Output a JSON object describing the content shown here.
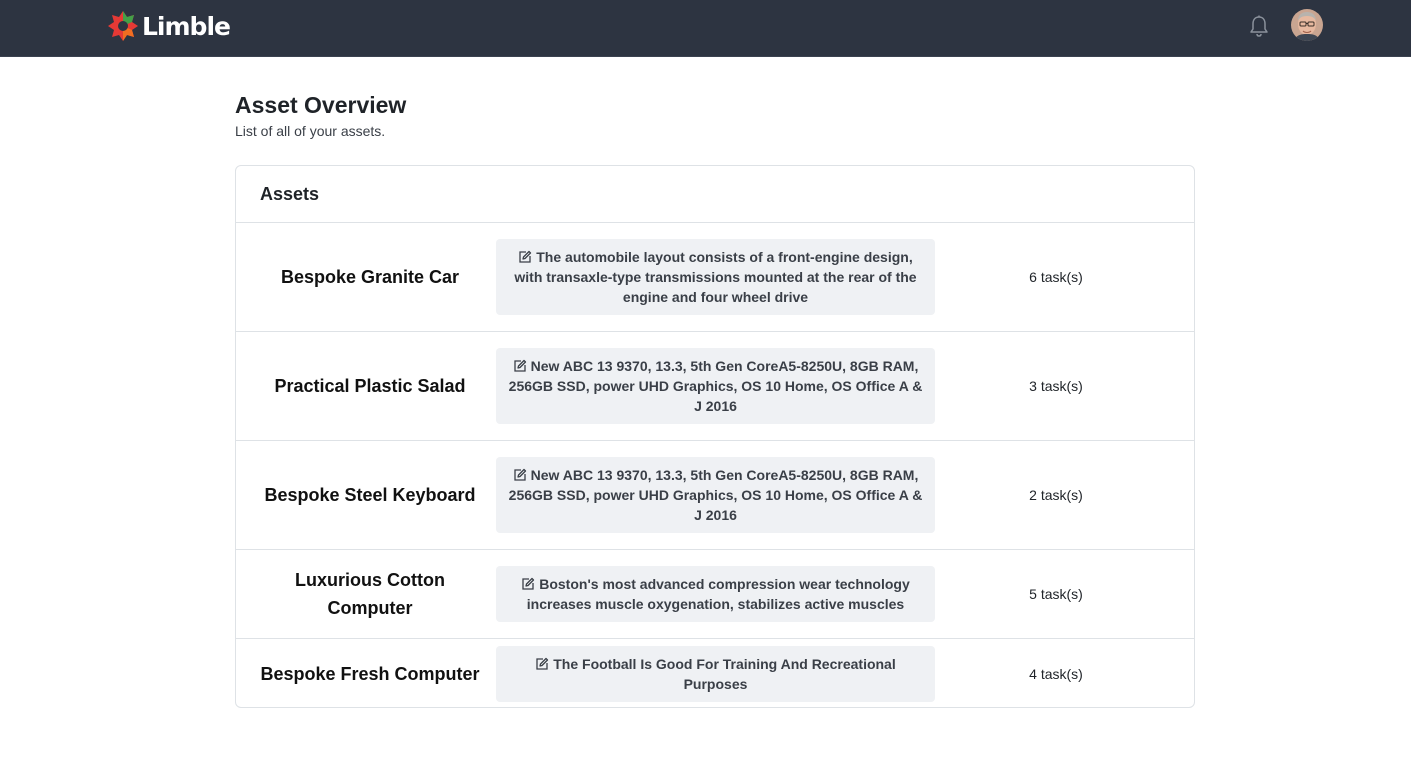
{
  "header": {
    "brand": "Limble",
    "brand_colors": {
      "orange": "#f26d21",
      "red": "#e53935",
      "green": "#43a047"
    },
    "notification_icon": "bell-icon",
    "avatar_icon": "user-avatar"
  },
  "page": {
    "title": "Asset Overview",
    "subtitle": "List of all of your assets."
  },
  "card": {
    "title": "Assets",
    "rows": [
      {
        "name": "Bespoke Granite Car",
        "description": "The automobile layout consists of a front-engine design, with transaxle-type transmissions mounted at the rear of the engine and four wheel drive",
        "tasks": "6 task(s)"
      },
      {
        "name": "Practical Plastic Salad",
        "description": "New ABC 13 9370, 13.3, 5th Gen CoreA5-8250U, 8GB RAM, 256GB SSD, power UHD Graphics, OS 10 Home, OS Office A & J 2016",
        "tasks": "3 task(s)"
      },
      {
        "name": "Bespoke Steel Keyboard",
        "description": "New ABC 13 9370, 13.3, 5th Gen CoreA5-8250U, 8GB RAM, 256GB SSD, power UHD Graphics, OS 10 Home, OS Office A & J 2016",
        "tasks": "2 task(s)"
      },
      {
        "name": "Luxurious Cotton Computer",
        "description": "Boston's most advanced compression wear technology increases muscle oxygenation, stabilizes active muscles",
        "tasks": "5 task(s)"
      },
      {
        "name": "Bespoke Fresh Computer",
        "description": "The Football Is Good For Training And Recreational Purposes",
        "tasks": "4 task(s)"
      }
    ]
  }
}
